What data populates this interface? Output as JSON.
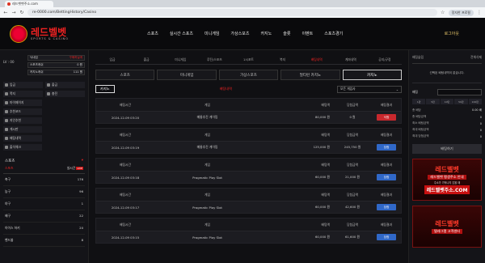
{
  "browser": {
    "tab_title": "레드벳벳주소.com",
    "url": "re-0000.com/BettingHistory/Casino",
    "account": "정지한 프로필"
  },
  "header": {
    "logo_text": "레드벨벳",
    "logo_sub": "SPORTS & CASINO",
    "nav": [
      "스포츠",
      "실시간 스포츠",
      "미니게임",
      "가상스포츠",
      "카지노",
      "슬롯",
      "이벤트",
      "스포츠경기"
    ],
    "logout": "로그아웃"
  },
  "left": {
    "user_id": "LV : 00",
    "rows": [
      {
        "label": "닉네임",
        "value": "구매하실게"
      },
      {
        "label": "스포츠캐쉬",
        "value": "0 원"
      },
      {
        "label": "카지노캐쉬",
        "value": "111 원"
      }
    ],
    "btns": [
      "입금",
      "출금",
      "쪽지",
      "충전"
    ],
    "menu": [
      "마이페이지",
      "추천코드",
      "지인추천",
      "게시판",
      "배팅내역",
      "출석체크"
    ],
    "sports_header": "스포츠",
    "sport_tabs": [
      "스포츠",
      "실시간",
      "LIVE"
    ],
    "sports": [
      {
        "name": "축구",
        "count": "176"
      },
      {
        "name": "농구",
        "count": "96"
      },
      {
        "name": "야구",
        "count": "1"
      },
      {
        "name": "배구",
        "count": "22"
      },
      {
        "name": "아이스 하키",
        "count": "20"
      },
      {
        "name": "핸드볼",
        "count": "8"
      }
    ]
  },
  "center": {
    "cat_tabs": [
      "입금",
      "출금",
      "미니게임",
      "루틴/스포츠",
      "1시포트",
      "복지",
      "배팅내역",
      "계좌내역",
      "공지/규정"
    ],
    "cat_active": 6,
    "sub_tabs": [
      "스포츠",
      "미니게임",
      "가상스포츠",
      "멀티런 카지노",
      "카지노"
    ],
    "sub_active": 4,
    "filter_btn": "카지노",
    "filter_title": "배팅내역",
    "filter_select": "모든 게임사",
    "col_headers": [
      "배팅시간",
      "게임",
      "배팅액",
      "당첨금액",
      "배팅결과"
    ],
    "bets": [
      {
        "time": "2024-12-09 03:20",
        "game": "메롱추진 게이밍",
        "amount": "80,000 원",
        "win": "0 원",
        "result": "낙첨",
        "color": "red"
      },
      {
        "time": "2024-12-09 03:19",
        "game": "메롱추진 게이밍",
        "amount": "125,000 원",
        "win": "245,750 원",
        "result": "당첨",
        "color": "blue"
      },
      {
        "time": "2024-12-09 03:18",
        "game": "Pragmatic Play Slot",
        "amount": "60,000 원",
        "win": "21,000 원",
        "result": "당첨",
        "color": "blue"
      },
      {
        "time": "2024-12-09 03:17",
        "game": "Pragmatic Play Slot",
        "amount": "60,000 원",
        "win": "42,600 원",
        "result": "당첨",
        "color": "blue"
      },
      {
        "time": "2024-12-09 03:15",
        "game": "Pragmatic Play Slot",
        "amount": "60,000 원",
        "win": "61,600 원",
        "result": "당첨",
        "color": "blue"
      }
    ]
  },
  "right": {
    "slip_title": "배팅슬립",
    "slip_right": "전체삭제",
    "slip_msg": "선택된 배팅내역이 없습니다.",
    "amount_label": "배팅",
    "chips": [
      "1만",
      "5만",
      "10만",
      "50만",
      "100만"
    ],
    "lines": [
      {
        "label": "총 배당",
        "value": "0.00 배"
      },
      {
        "label": "총 배당금액",
        "value": "0"
      },
      {
        "label": "최소 배팅금액",
        "value": "0"
      },
      {
        "label": "최대 배팅금액",
        "value": "0"
      },
      {
        "label": "최대 당첨금액",
        "value": "0"
      }
    ],
    "bet_btn": "배팅하기",
    "banner1": {
      "title": "레드벨벳",
      "sub": "레드벨벳 평생주소 안내",
      "note": "주소가 기억나지 않을 때",
      "url": "레드벨벳주소.COM"
    },
    "banner2": {
      "title": "레드벨벳",
      "sub": "텔레그램 고객센터",
      "note": "",
      "url": ""
    }
  }
}
